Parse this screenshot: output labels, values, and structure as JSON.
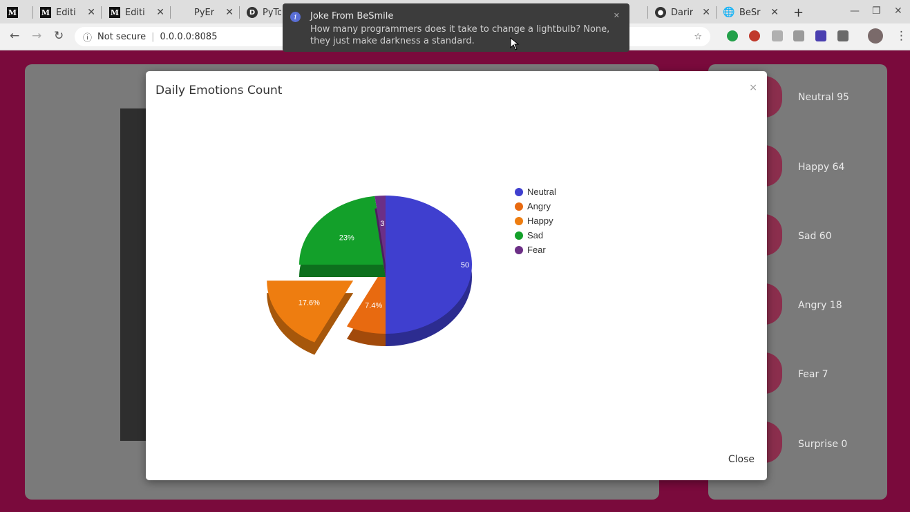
{
  "browser": {
    "tabs": [
      {
        "title": "",
        "icon": "medium-icon"
      },
      {
        "title": "Editi",
        "icon": "medium-icon"
      },
      {
        "title": "Editi",
        "icon": "medium-icon"
      },
      {
        "title": "PyEr",
        "icon": "blank-icon"
      },
      {
        "title": "PyTo",
        "icon": "site-icon"
      },
      {
        "title": "Darir",
        "icon": "github-icon"
      },
      {
        "title": "BeSr",
        "icon": "globe-icon"
      }
    ],
    "new_tab": "+",
    "security": "Not secure",
    "url": "0.0.0.0:8085"
  },
  "notification": {
    "title": "Joke From BeSmile",
    "body": "How many programmers does it take to change a lightbulb? None, they just make darkness a standard."
  },
  "stats": [
    {
      "label": "Neutral 95"
    },
    {
      "label": "Happy 64"
    },
    {
      "label": "Sad 60"
    },
    {
      "label": "Angry 18"
    },
    {
      "label": "Fear 7"
    },
    {
      "label": "Surprise 0"
    }
  ],
  "modal": {
    "title": "Daily Emotions Count",
    "close_x": "×",
    "close_button": "Close"
  },
  "chart_data": {
    "type": "pie",
    "title": "Daily Emotions Count",
    "slices": [
      {
        "name": "Neutral",
        "value": 50,
        "label": "50",
        "color": "#3f3fcf"
      },
      {
        "name": "Angry",
        "value": 7.4,
        "label": "7.4%",
        "color": "#e86a10"
      },
      {
        "name": "Happy",
        "value": 17.6,
        "label": "17.6%",
        "color": "#ee7d10"
      },
      {
        "name": "Sad",
        "value": 23,
        "label": "23%",
        "color": "#13a02a"
      },
      {
        "name": "Fear",
        "value": 2,
        "label": "3",
        "color": "#6c2f86"
      }
    ],
    "legend": [
      "Neutral",
      "Angry",
      "Happy",
      "Sad",
      "Fear"
    ],
    "legend_position": "right",
    "exploded_slice": "Happy"
  }
}
